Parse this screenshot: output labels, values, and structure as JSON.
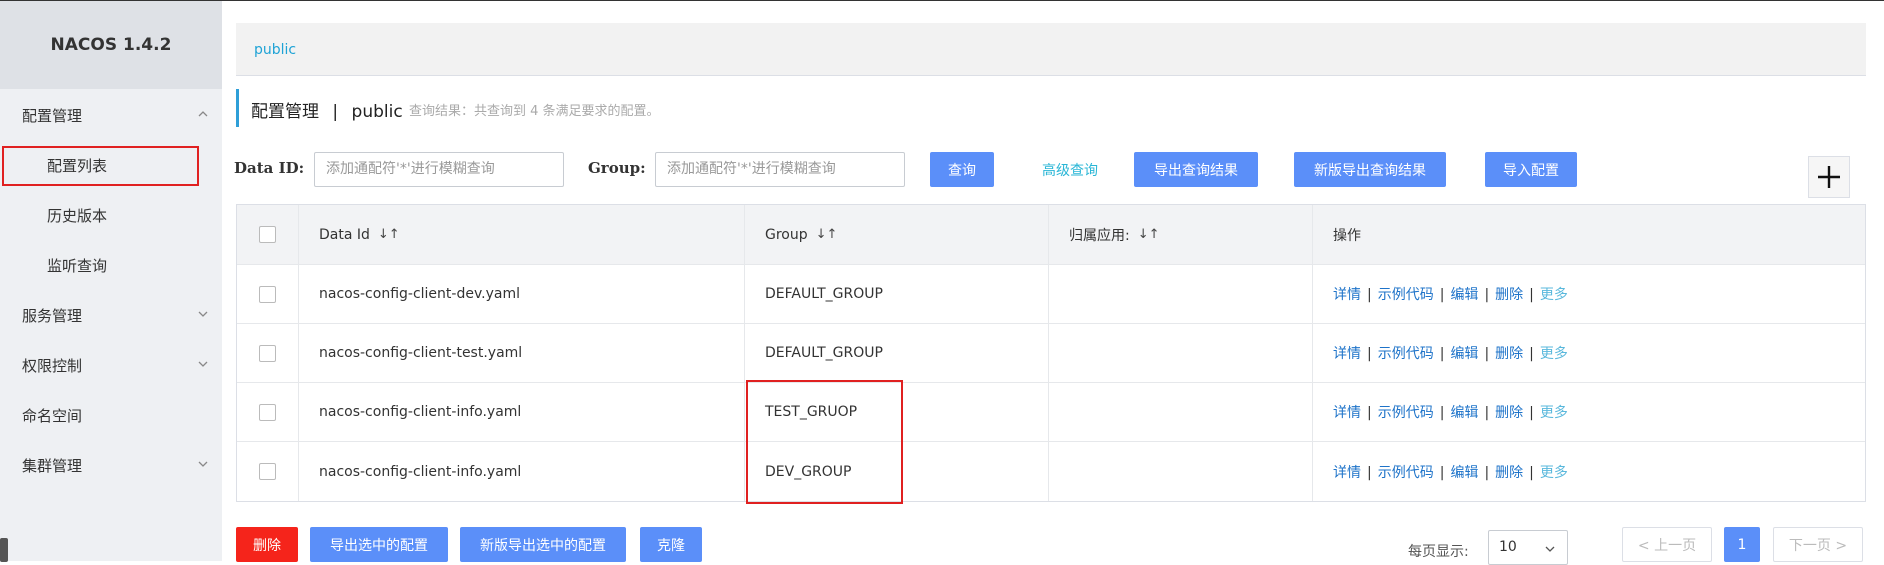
{
  "sidebar": {
    "brand": "NACOS 1.4.2",
    "items": [
      {
        "label": "配置管理"
      },
      {
        "label": "配置列表"
      },
      {
        "label": "历史版本"
      },
      {
        "label": "监听查询"
      },
      {
        "label": "服务管理"
      },
      {
        "label": "权限控制"
      },
      {
        "label": "命名空间"
      },
      {
        "label": "集群管理"
      }
    ]
  },
  "breadcrumb": "public",
  "title": {
    "section": "配置管理",
    "divider": "|",
    "namespace": "public",
    "query_result": "查询结果：共查询到 4 条满足要求的配置。"
  },
  "search": {
    "dataid_label": "Data ID:",
    "dataid_placeholder": "添加通配符'*'进行模糊查询",
    "group_label": "Group:",
    "group_placeholder": "添加通配符'*'进行模糊查询",
    "query_btn": "查询",
    "advanced": "高级查询",
    "export_btn": "导出查询结果",
    "new_export_btn": "新版导出查询结果",
    "import_btn": "导入配置"
  },
  "table": {
    "headers": [
      "Data Id",
      "Group",
      "归属应用:",
      "操作"
    ],
    "sort_glyph": "↓↑",
    "rows": [
      {
        "dataid": "nacos-config-client-dev.yaml",
        "group": "DEFAULT_GROUP",
        "app": ""
      },
      {
        "dataid": "nacos-config-client-test.yaml",
        "group": "DEFAULT_GROUP",
        "app": ""
      },
      {
        "dataid": "nacos-config-client-info.yaml",
        "group": "TEST_GRUOP",
        "app": ""
      },
      {
        "dataid": "nacos-config-client-info.yaml",
        "group": "DEV_GROUP",
        "app": ""
      }
    ],
    "ops": {
      "detail": "详情",
      "sample": "示例代码",
      "edit": "编辑",
      "delete": "删除",
      "more": "更多",
      "sep": "|"
    }
  },
  "bottom": {
    "delete_btn": "删除",
    "export_selected_btn": "导出选中的配置",
    "new_export_selected_btn": "新版导出选中的配置",
    "clone_btn": "克隆",
    "page_size_label": "每页显示:",
    "page_size": "10",
    "prev": "< 上一页",
    "current_page": "1",
    "next": "下一页 >"
  },
  "colors": {
    "accent": "#5b8ff9",
    "danger": "#f5241b",
    "highlight_box": "#e02020",
    "link": "#1e73c9"
  }
}
